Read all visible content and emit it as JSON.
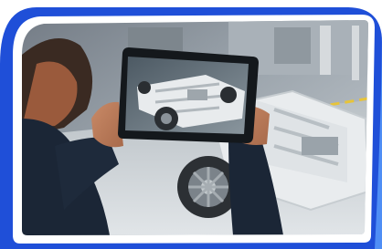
{
  "image": {
    "subject": "person-holding-tablet-ar-car-chassis",
    "frame_color": "#1f4fd8",
    "accent_color": "#4f8ef5",
    "background_color": "#ffffff",
    "floor_stripe_color": "#e7c43a"
  }
}
